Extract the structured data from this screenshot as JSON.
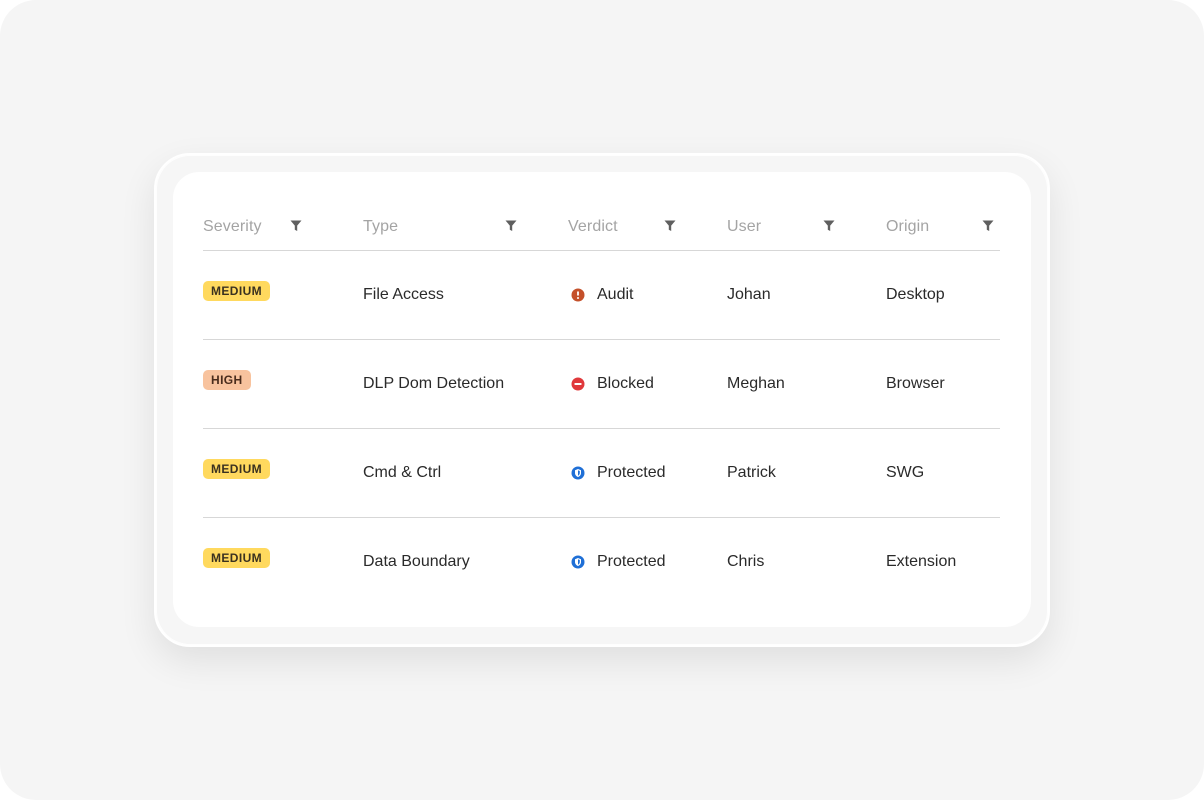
{
  "columns": [
    {
      "label": "Severity"
    },
    {
      "label": "Type"
    },
    {
      "label": "Verdict"
    },
    {
      "label": "User"
    },
    {
      "label": "Origin"
    }
  ],
  "rows": [
    {
      "severity": "MEDIUM",
      "severity_level": "medium",
      "type": "File Access",
      "verdict": "Audit",
      "verdict_icon": "alert-circle-icon",
      "user": "Johan",
      "origin": "Desktop"
    },
    {
      "severity": "HIGH",
      "severity_level": "high",
      "type": "DLP Dom Detection",
      "verdict": "Blocked",
      "verdict_icon": "blocked-icon",
      "user": "Meghan",
      "origin": "Browser"
    },
    {
      "severity": "MEDIUM",
      "severity_level": "medium",
      "type": "Cmd & Ctrl",
      "verdict": "Protected",
      "verdict_icon": "shield-icon",
      "user": "Patrick",
      "origin": "SWG"
    },
    {
      "severity": "MEDIUM",
      "severity_level": "medium",
      "type": "Data Boundary",
      "verdict": "Protected",
      "verdict_icon": "shield-icon",
      "user": "Chris",
      "origin": "Extension"
    }
  ],
  "colors": {
    "medium_badge": "#ffd95e",
    "high_badge": "#f8c39e",
    "audit": "#c4502a",
    "blocked": "#e0383b",
    "protected": "#1f6fd6"
  }
}
